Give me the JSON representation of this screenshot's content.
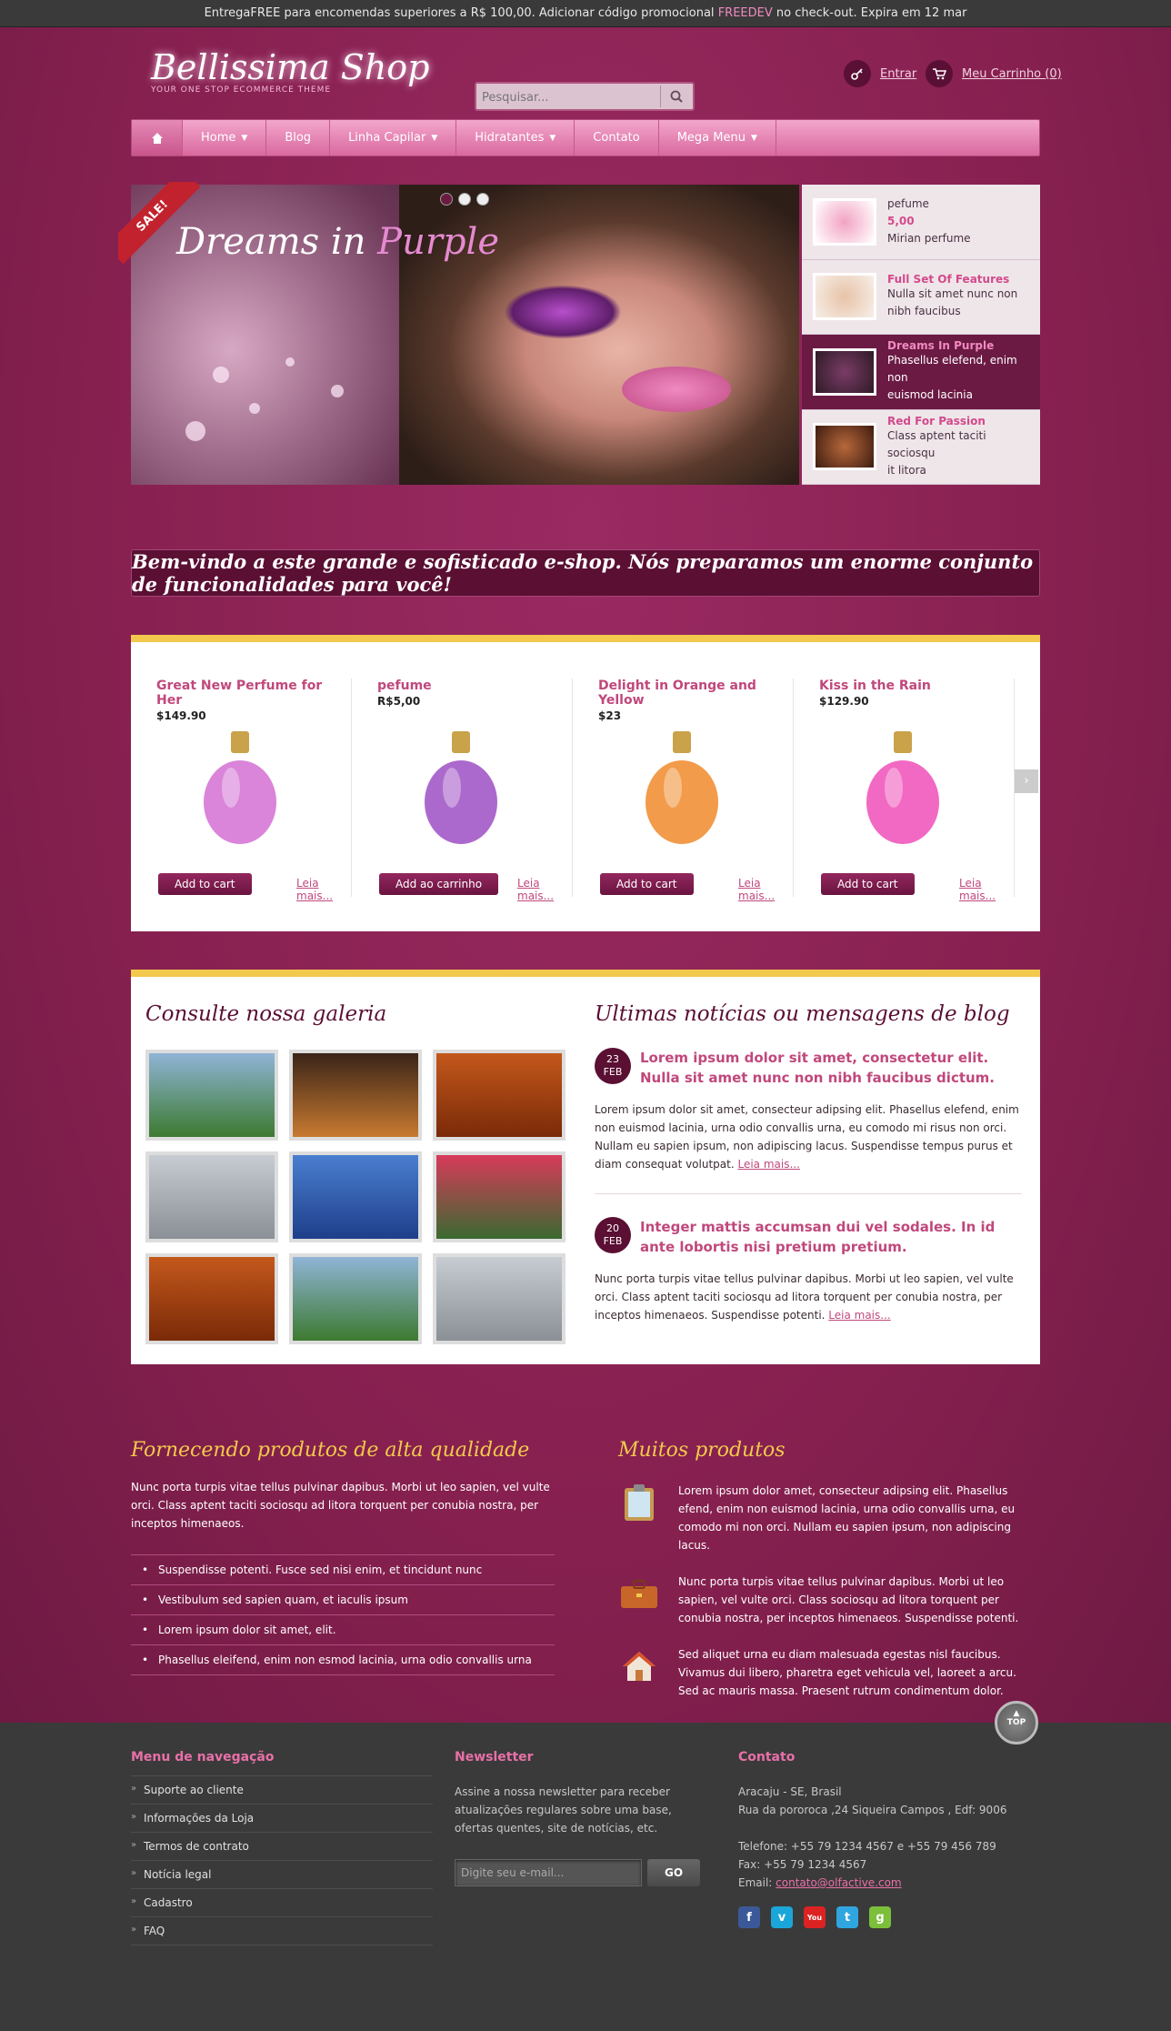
{
  "topbar": {
    "text_before": "EntregaFREE para encomendas superiores a R$ 100,00. Adicionar código promocional ",
    "code": "FREEDEV",
    "text_after": " no check-out. Expira em 12 mar"
  },
  "logo": {
    "name": "Bellissima Shop",
    "tagline": "YOUR ONE STOP ECOMMERCE THEME"
  },
  "search": {
    "placeholder": "Pesquisar..."
  },
  "header": {
    "login": "Entrar",
    "cart": "Meu Carrinho (0)"
  },
  "nav": {
    "items": [
      {
        "label": "Home",
        "dropdown": true
      },
      {
        "label": "Blog",
        "dropdown": false
      },
      {
        "label": "Linha Capilar",
        "dropdown": true
      },
      {
        "label": "Hidratantes",
        "dropdown": true
      },
      {
        "label": "Contato",
        "dropdown": false
      },
      {
        "label": "Mega Menu",
        "dropdown": true
      }
    ]
  },
  "slider": {
    "title_a": "Dreams in ",
    "title_b": "Purple",
    "sale": "SALE!",
    "thumbs": [
      {
        "t": "",
        "d1": "pefume",
        "d2": "5,00",
        "d3": "Mirian perfume",
        "colors": [
          "#f2a3c2",
          "#fff"
        ]
      },
      {
        "t": "Full Set Of Features",
        "d1": "Nulla sit amet nunc non",
        "d2": "nibh faucibus",
        "colors": [
          "#e7c3a8",
          "#f7efe8"
        ]
      },
      {
        "t": "Dreams In Purple",
        "d1": "Phasellus elefend, enim non",
        "d2": "euismod lacinia",
        "colors": [
          "#7a3c66",
          "#2e1a26"
        ]
      },
      {
        "t": "Red For Passion",
        "d1": "Class aptent taciti sociosqu",
        "d2": "it litora",
        "colors": [
          "#b8683b",
          "#3d1c10"
        ]
      }
    ]
  },
  "welcome": "Bem-vindo a este grande e sofisticado e-shop. Nós preparamos um enorme conjunto de funcionalidades para você!",
  "products": [
    {
      "name": "Great New Perfume for Her",
      "price": "$149.90",
      "button": "Add to cart",
      "more": "Leia mais...",
      "color": "#d46fd4"
    },
    {
      "name": "pefume",
      "price": "R$5,00",
      "button": "Add ao carrinho",
      "more": "Leia mais...",
      "color": "#9d4fc4"
    },
    {
      "name": "Delight in Orange and Yellow",
      "price": "$23",
      "button": "Add to cart",
      "more": "Leia mais...",
      "color": "#f08a2a"
    },
    {
      "name": "Kiss in the Rain",
      "price": "$129.90",
      "button": "Add to cart",
      "more": "Leia mais...",
      "color": "#f04fb8"
    }
  ],
  "gallery": {
    "title": "Consulte nossa galeria",
    "images": [
      [
        "#8fb4d6",
        "#3d7a30"
      ],
      [
        "#3a2418",
        "#c87a30"
      ],
      [
        "#c4581c",
        "#7a2a08"
      ],
      [
        "#c6ccd2",
        "#8a9096"
      ],
      [
        "#4a7ed0",
        "#1e3f8a"
      ],
      [
        "#d83a5a",
        "#3a6a30"
      ],
      [
        "#c4581c",
        "#7a2a08"
      ],
      [
        "#8fb4d6",
        "#3d7a30"
      ],
      [
        "#c6ccd2",
        "#8a9096"
      ]
    ]
  },
  "blog": {
    "title": "Ultimas notícias ou mensagens de blog",
    "posts": [
      {
        "day": "23",
        "month": "FEB",
        "title": "Lorem ipsum dolor sit amet, consectetur elit. Nulla sit amet nunc non nibh faucibus dictum.",
        "body": "Lorem ipsum dolor sit amet, consecteur adipsing elit. Phasellus elefend, enim non euismod lacinia, urna odio convallis urna, eu comodo mi risus non orci. Nullam eu sapien ipsum, non adipiscing lacus. Suspendisse tempus purus et diam consequat volutpat. ",
        "more": "Leia mais..."
      },
      {
        "day": "20",
        "month": "FEB",
        "title": "Integer mattis accumsan dui vel sodales. In id ante lobortis nisi pretium pretium.",
        "body": "Nunc porta turpis vitae tellus pulvinar dapibus. Morbi ut leo sapien, vel vulte orci. Class aptent taciti sociosqu ad litora torquent per conubia nostra, per inceptos himenaeos. Suspendisse potenti. ",
        "more": "Leia mais..."
      }
    ]
  },
  "quality": {
    "title": "Fornecendo produtos de alta qualidade",
    "text": "Nunc porta turpis vitae tellus pulvinar dapibus. Morbi ut leo sapien, vel vulte orci. Class aptent taciti sociosqu ad litora torquent per conubia nostra, per inceptos himenaeos.",
    "list": [
      "Suspendisse potenti. Fusce sed nisi enim, et tincidunt nunc",
      "Vestibulum sed sapien quam, et iaculis ipsum",
      "Lorem ipsum dolor sit amet, elit.",
      "Phasellus eleifend, enim non esmod lacinia, urna odio convallis urna"
    ]
  },
  "many": {
    "title": "Muitos produtos",
    "rows": [
      {
        "icon": "clipboard-icon",
        "text": "Lorem ipsum dolor amet, consecteur adipsing elit. Phasellus efend, enim non euismod lacinia, urna odio convallis urna, eu comodo mi non orci. Nullam eu sapien ipsum, non adipiscing lacus."
      },
      {
        "icon": "briefcase-icon",
        "text": "Nunc porta turpis vitae tellus pulvinar dapibus. Morbi ut leo sapien, vel vulte orci. Class sociosqu ad litora torquent per conubia nostra, per inceptos himenaeos. Suspendisse potenti."
      },
      {
        "icon": "house-icon",
        "text": "Sed aliquet urna eu diam malesuada egestas nisl faucibus. Vivamus dui libero, pharetra eget vehicula vel, laoreet a arcu. Sed ac mauris massa. Praesent rutrum condimentum dolor."
      }
    ]
  },
  "top_label": "TOP",
  "footer": {
    "nav_title": "Menu de navegação",
    "nav": [
      "Suporte ao cliente",
      "Informações da Loja",
      "Termos de contrato",
      "Notícia legal",
      "Cadastro",
      "FAQ"
    ],
    "news_title": "Newsletter",
    "news_text": "Assine a nossa newsletter para receber atualizações regulares sobre uma base, ofertas quentes, site de notícias, etc.",
    "news_placeholder": "Digite seu e-mail...",
    "news_button": "GO",
    "contact_title": "Contato",
    "contact_l1": "Aracaju - SE, Brasil",
    "contact_l2": "Rua da pororoca ,24 Siqueira Campos , Edf: 9006",
    "phone": "Telefone: +55 79 1234 4567 e +55 79 456 789",
    "fax": "Fax: +55 79 1234 4567",
    "email_label": "Email: ",
    "email": "contato@olfactive.com",
    "social": [
      {
        "name": "facebook-icon",
        "glyph": "f",
        "color": "#3b5998"
      },
      {
        "name": "vimeo-icon",
        "glyph": "v",
        "color": "#1aa6d8"
      },
      {
        "name": "youtube-icon",
        "glyph": "You",
        "color": "#d22"
      },
      {
        "name": "twitter-icon",
        "glyph": "t",
        "color": "#2fa6e0"
      },
      {
        "name": "google-icon",
        "glyph": "g",
        "color": "#7cbf3a"
      }
    ]
  },
  "colors": {
    "accent": "#c0487c",
    "brand": "#8c2157",
    "dark": "#5a0f33",
    "gold": "#f2c94c"
  }
}
